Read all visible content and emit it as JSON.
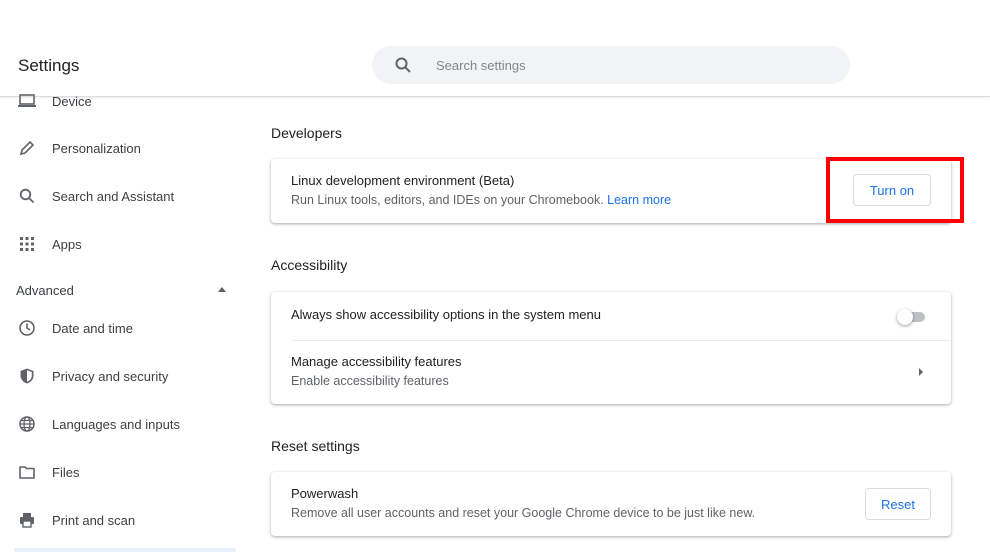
{
  "app": {
    "title": "Settings"
  },
  "search": {
    "placeholder": "Search settings"
  },
  "sidebar": {
    "items": [
      {
        "label": "Device",
        "icon": "laptop-icon"
      },
      {
        "label": "Personalization",
        "icon": "pencil-icon"
      },
      {
        "label": "Search and Assistant",
        "icon": "search-icon"
      },
      {
        "label": "Apps",
        "icon": "apps-grid-icon"
      }
    ],
    "advanced_label": "Advanced",
    "advanced_items": [
      {
        "label": "Date and time",
        "icon": "clock-icon"
      },
      {
        "label": "Privacy and security",
        "icon": "shield-icon"
      },
      {
        "label": "Languages and inputs",
        "icon": "globe-icon"
      },
      {
        "label": "Files",
        "icon": "folder-icon"
      },
      {
        "label": "Print and scan",
        "icon": "printer-icon"
      }
    ]
  },
  "developers": {
    "title": "Developers",
    "linux_title": "Linux development environment (Beta)",
    "linux_sub": "Run Linux tools, editors, and IDEs on your Chromebook.",
    "learn_more": "Learn more",
    "turn_on": "Turn on"
  },
  "accessibility": {
    "title": "Accessibility",
    "always_show": "Always show accessibility options in the system menu",
    "toggle_on": false,
    "manage_title": "Manage accessibility features",
    "manage_sub": "Enable accessibility features"
  },
  "reset": {
    "title": "Reset settings",
    "powerwash_title": "Powerwash",
    "powerwash_sub": "Remove all user accounts and reset your Google Chrome device to be just like new.",
    "reset_button": "Reset"
  },
  "colors": {
    "accent": "#1a73e8",
    "highlight": "#ff0000"
  }
}
